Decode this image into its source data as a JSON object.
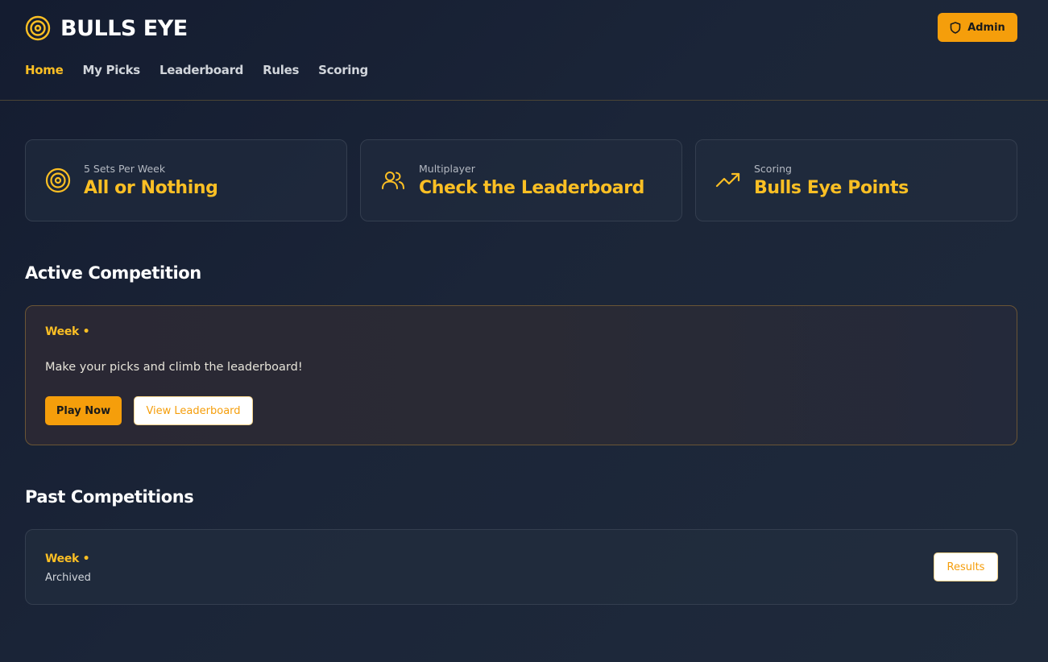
{
  "app": {
    "title": "BULLS EYE",
    "logo_icon": "target-icon",
    "accent_color": "#f59e0b",
    "highlight_color": "#fbbf24"
  },
  "header": {
    "admin_label": "Admin",
    "admin_icon": "shield-icon"
  },
  "nav": {
    "items": [
      {
        "label": "Home",
        "active": true
      },
      {
        "label": "My Picks",
        "active": false
      },
      {
        "label": "Leaderboard",
        "active": false
      },
      {
        "label": "Rules",
        "active": false
      },
      {
        "label": "Scoring",
        "active": false
      }
    ]
  },
  "features": [
    {
      "icon": "target-icon",
      "subtitle": "5 Sets Per Week",
      "title": "All or Nothing"
    },
    {
      "icon": "users-icon",
      "subtitle": "Multiplayer",
      "title": "Check the Leaderboard"
    },
    {
      "icon": "trending-up-icon",
      "subtitle": "Scoring",
      "title": "Bulls Eye Points"
    }
  ],
  "active_competition": {
    "section_title": "Active Competition",
    "week_label": "Week •",
    "description": "Make your picks and climb the leaderboard!",
    "play_label": "Play Now",
    "leaderboard_label": "View Leaderboard"
  },
  "past_competitions": {
    "section_title": "Past Competitions",
    "items": [
      {
        "week_label": "Week •",
        "status": "Archived",
        "results_label": "Results"
      }
    ]
  }
}
